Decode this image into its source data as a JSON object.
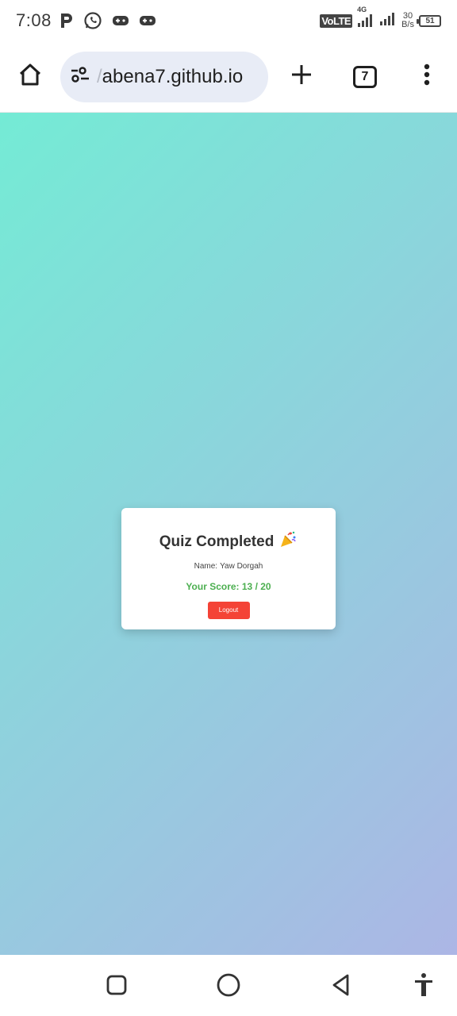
{
  "status_bar": {
    "time": "7:08",
    "network_label": "VoLTE",
    "network_gen": "4G",
    "speed_value": "30",
    "speed_unit": "B/s",
    "battery_level": "51"
  },
  "browser": {
    "url_fade": "/",
    "url": "abena7.github.io",
    "tab_count": "7"
  },
  "page": {
    "background_colors": [
      "#74ebd5",
      "#acb6e5"
    ],
    "card": {
      "title": "Quiz Completed",
      "name_label": "Name:",
      "name_value": "Yaw Dorgah",
      "score_text": "Your Score: 13 / 20",
      "score_color": "#4caf50",
      "logout_label": "Logout",
      "logout_color": "#f44336"
    }
  },
  "icons": {
    "status_left": [
      "parking-icon",
      "whatsapp-icon",
      "gamepad-icon",
      "gamepad-icon"
    ],
    "toolbar": [
      "home-icon",
      "site-settings-icon",
      "plus-icon",
      "tabs-icon",
      "more-vert-icon"
    ],
    "nav": [
      "recents-icon",
      "home-circle-icon",
      "back-icon",
      "accessibility-icon"
    ]
  }
}
